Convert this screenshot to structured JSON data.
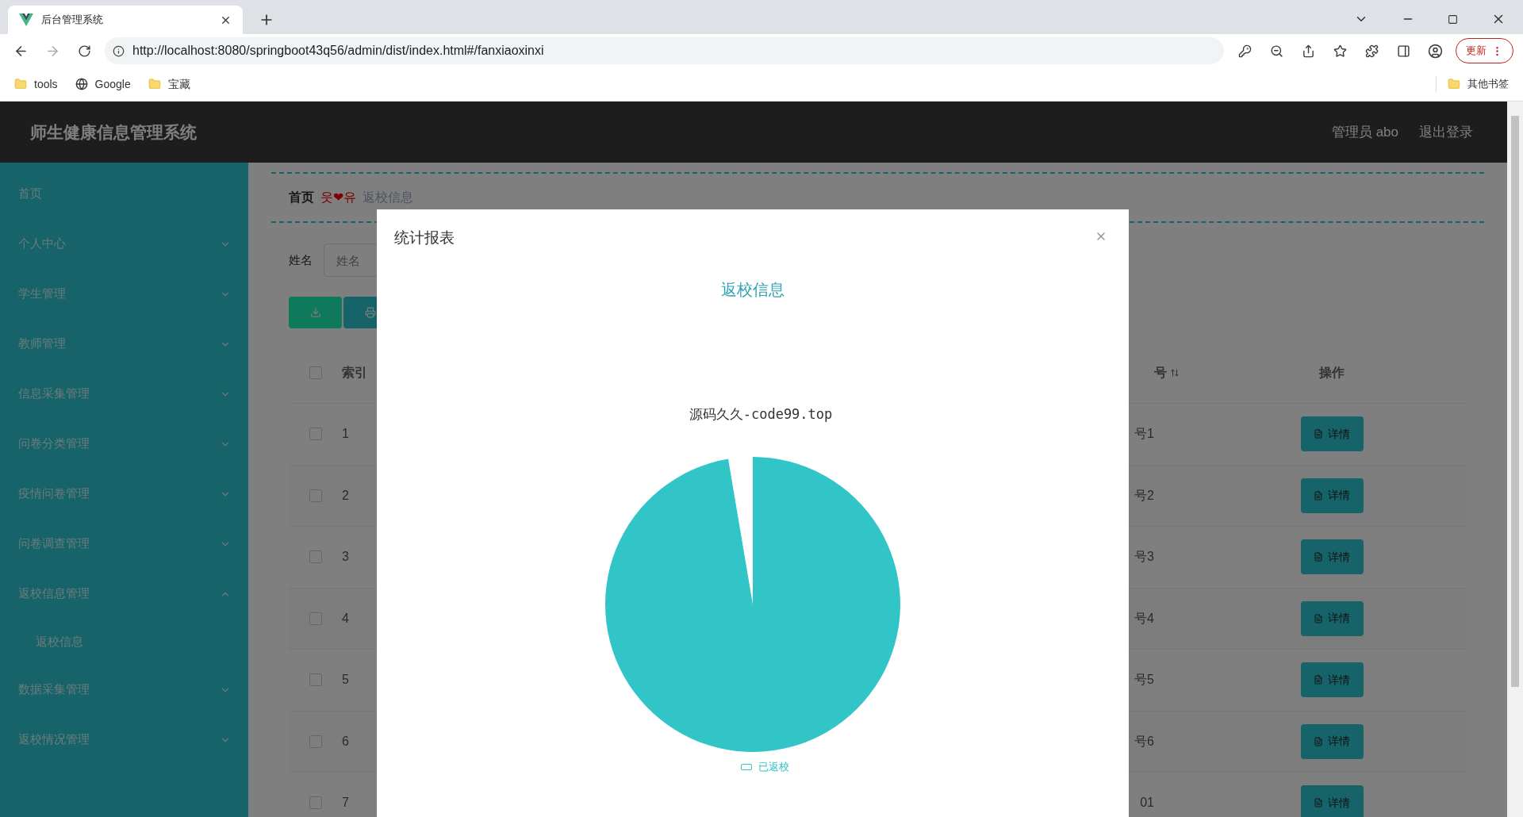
{
  "browser": {
    "tab_title": "后台管理系统",
    "url": "http://localhost:8080/springboot43q56/admin/dist/index.html#/fanxiaoxinxi",
    "update_button": "更新",
    "bookmarks": [
      {
        "label": "tools",
        "kind": "folder"
      },
      {
        "label": "Google",
        "kind": "globe"
      },
      {
        "label": "宝藏",
        "kind": "folder"
      }
    ],
    "other_bookmarks": "其他书签"
  },
  "header": {
    "title": "师生健康信息管理系统",
    "user": "管理员 abo",
    "logout": "退出登录"
  },
  "sidebar": {
    "items": [
      {
        "label": "首页",
        "kind": "link"
      },
      {
        "label": "个人中心",
        "kind": "menu",
        "expanded": false
      },
      {
        "label": "学生管理",
        "kind": "menu",
        "expanded": false
      },
      {
        "label": "教师管理",
        "kind": "menu",
        "expanded": false
      },
      {
        "label": "信息采集管理",
        "kind": "menu",
        "expanded": false
      },
      {
        "label": "问卷分类管理",
        "kind": "menu",
        "expanded": false
      },
      {
        "label": "疫情问卷管理",
        "kind": "menu",
        "expanded": false
      },
      {
        "label": "问卷调查管理",
        "kind": "menu",
        "expanded": false
      },
      {
        "label": "返校信息管理",
        "kind": "menu",
        "expanded": true,
        "children": [
          {
            "label": "返校信息"
          }
        ]
      },
      {
        "label": "数据采集管理",
        "kind": "menu",
        "expanded": false
      },
      {
        "label": "返校情况管理",
        "kind": "menu",
        "expanded": false
      }
    ]
  },
  "breadcrumb": {
    "home": "首页",
    "separator": "웃❤유",
    "current": "返校信息"
  },
  "search": {
    "label": "姓名",
    "placeholder": "姓名"
  },
  "table": {
    "columns": [
      "索引",
      "号",
      "操作"
    ],
    "all_checked": false,
    "rows": [
      {
        "checked": false,
        "index": "1",
        "column_2": "号1",
        "action": "详情"
      },
      {
        "checked": false,
        "index": "2",
        "column_2": "号2",
        "action": "详情"
      },
      {
        "checked": false,
        "index": "3",
        "column_2": "号3",
        "action": "详情"
      },
      {
        "checked": false,
        "index": "4",
        "column_2": "号4",
        "action": "详情"
      },
      {
        "checked": false,
        "index": "5",
        "column_2": "号5",
        "action": "详情"
      },
      {
        "checked": false,
        "index": "6",
        "column_2": "号6",
        "action": "详情"
      },
      {
        "checked": false,
        "index": "7",
        "column_2": "01",
        "action": "详情"
      }
    ]
  },
  "modal": {
    "title": "统计报表",
    "heading": "返校信息",
    "chart_title": "源码久久-code99.top",
    "legend": [
      "已返校"
    ]
  }
}
